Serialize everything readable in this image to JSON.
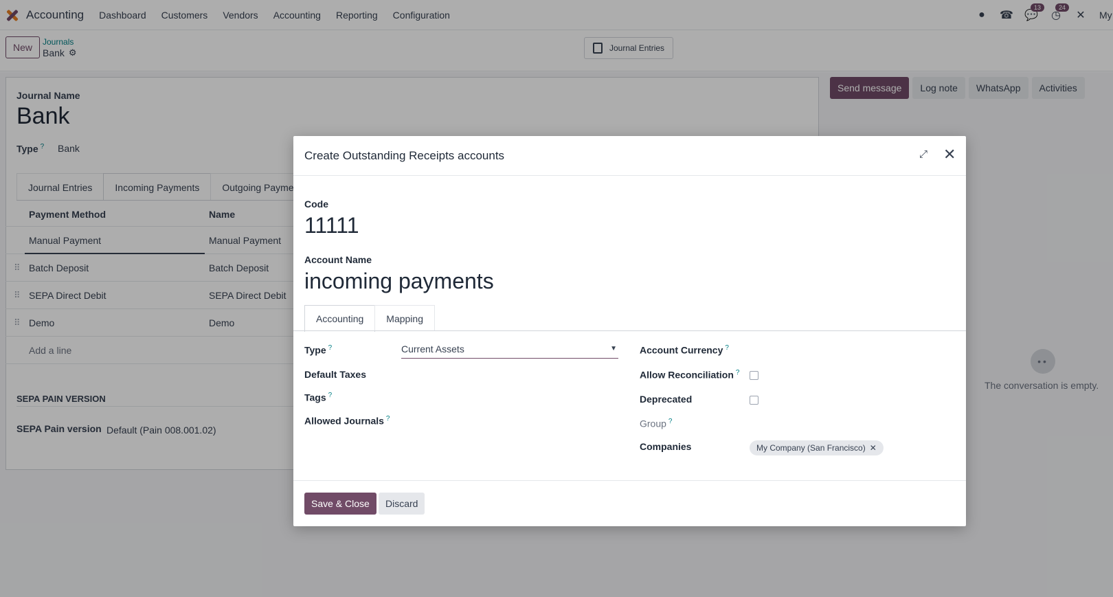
{
  "navbar": {
    "app_name": "Accounting",
    "menu": [
      "Dashboard",
      "Customers",
      "Vendors",
      "Accounting",
      "Reporting",
      "Configuration"
    ],
    "messages_badge": "13",
    "activities_badge": "24",
    "user": "My"
  },
  "control": {
    "new_label": "New",
    "breadcrumb_parent": "Journals",
    "breadcrumb_current": "Bank",
    "smart_button": "Journal Entries"
  },
  "form": {
    "journal_name_label": "Journal Name",
    "journal_name": "Bank",
    "type_label": "Type",
    "type_value": "Bank",
    "tabs": [
      "Journal Entries",
      "Incoming Payments",
      "Outgoing Payme"
    ],
    "table_headers": [
      "Payment Method",
      "Name"
    ],
    "rows": [
      {
        "method": "Manual Payment",
        "name": "Manual Payment"
      },
      {
        "method": "Batch Deposit",
        "name": "Batch Deposit"
      },
      {
        "method": "SEPA Direct Debit",
        "name": "SEPA Direct Debit"
      },
      {
        "method": "Demo",
        "name": "Demo"
      }
    ],
    "add_line": "Add a line",
    "sepa_section": "SEPA PAIN VERSION",
    "sepa_label": "SEPA Pain version",
    "sepa_value": "Default (Pain 008.001.02)"
  },
  "chatter": {
    "send_message": "Send message",
    "log_note": "Log note",
    "whatsapp": "WhatsApp",
    "activities": "Activities",
    "empty": "The conversation is empty."
  },
  "modal": {
    "title": "Create Outstanding Receipts accounts",
    "code_label": "Code",
    "code_value": "11111",
    "name_label": "Account Name",
    "name_value": "incoming payments",
    "tabs": [
      "Accounting",
      "Mapping"
    ],
    "type_label": "Type",
    "type_value": "Current Assets",
    "default_taxes_label": "Default Taxes",
    "tags_label": "Tags",
    "allowed_journals_label": "Allowed Journals",
    "account_currency_label": "Account Currency",
    "allow_reconciliation_label": "Allow Reconciliation",
    "deprecated_label": "Deprecated",
    "group_label": "Group",
    "companies_label": "Companies",
    "company_tag": "My Company (San Francisco)",
    "save_label": "Save & Close",
    "discard_label": "Discard"
  }
}
